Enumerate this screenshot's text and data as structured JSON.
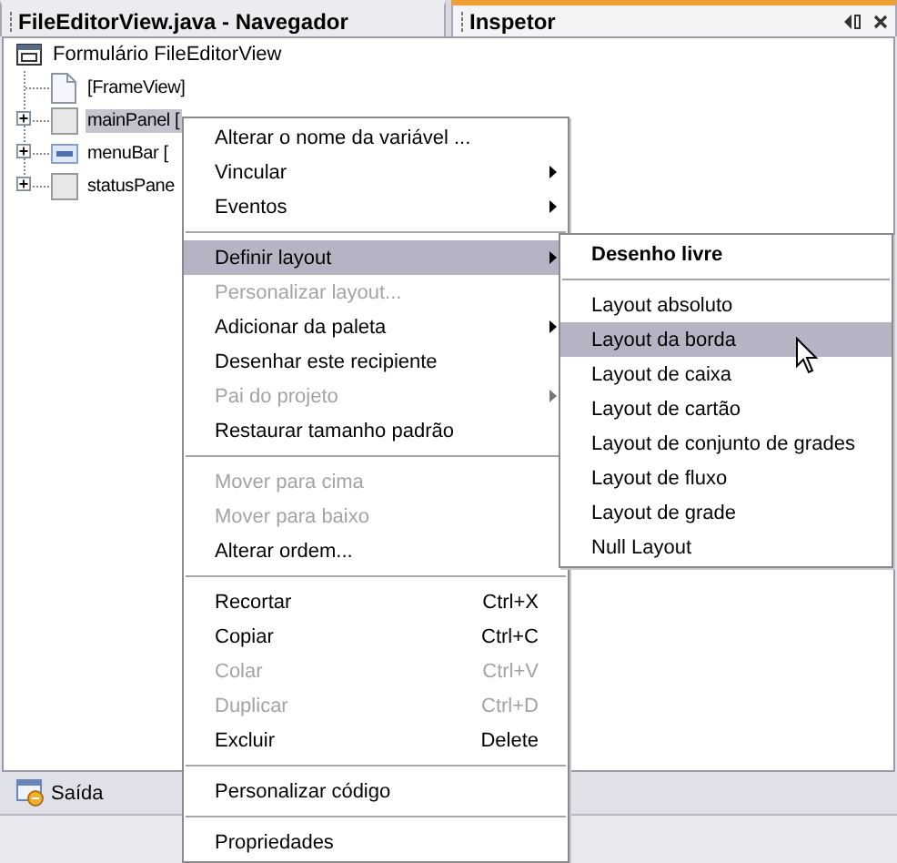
{
  "tabs": [
    {
      "label": "FileEditorView.java - Navegador",
      "selected": false
    },
    {
      "label": "Inspetor",
      "selected": true
    }
  ],
  "tree": {
    "label": "Formulário FileEditorView",
    "kind": "form",
    "children": [
      {
        "label": "[FrameView]",
        "kind": "frame",
        "expandable": false,
        "selected": false
      },
      {
        "label": "mainPanel [",
        "kind": "panel",
        "expandable": true,
        "selected": true
      },
      {
        "label": "menuBar [",
        "kind": "menubar",
        "expandable": true,
        "selected": false
      },
      {
        "label": "statusPane",
        "kind": "panel",
        "expandable": true,
        "selected": false
      }
    ]
  },
  "context_menu": {
    "items": [
      {
        "kind": "item",
        "label": "Alterar o nome da variável ...",
        "submenu": false,
        "disabled": false,
        "selected": false
      },
      {
        "kind": "item",
        "label": "Vincular",
        "submenu": true,
        "disabled": false,
        "selected": false
      },
      {
        "kind": "item",
        "label": "Eventos",
        "submenu": true,
        "disabled": false,
        "selected": false
      },
      {
        "kind": "separator"
      },
      {
        "kind": "item",
        "label": "Definir layout",
        "submenu": true,
        "disabled": false,
        "selected": true
      },
      {
        "kind": "item",
        "label": "Personalizar layout...",
        "submenu": false,
        "disabled": true,
        "selected": false
      },
      {
        "kind": "item",
        "label": "Adicionar da paleta",
        "submenu": true,
        "disabled": false,
        "selected": false
      },
      {
        "kind": "item",
        "label": "Desenhar este recipiente",
        "submenu": false,
        "disabled": false,
        "selected": false
      },
      {
        "kind": "item",
        "label": "Pai do projeto",
        "submenu": true,
        "disabled": true,
        "selected": false
      },
      {
        "kind": "item",
        "label": "Restaurar tamanho padrão",
        "submenu": false,
        "disabled": false,
        "selected": false
      },
      {
        "kind": "separator"
      },
      {
        "kind": "item",
        "label": "Mover para cima",
        "submenu": false,
        "disabled": true,
        "selected": false
      },
      {
        "kind": "item",
        "label": "Mover para baixo",
        "submenu": false,
        "disabled": true,
        "selected": false
      },
      {
        "kind": "item",
        "label": "Alterar ordem...",
        "submenu": false,
        "disabled": false,
        "selected": false
      },
      {
        "kind": "separator"
      },
      {
        "kind": "item",
        "label": "Recortar",
        "shortcut": "Ctrl+X",
        "submenu": false,
        "disabled": false,
        "selected": false
      },
      {
        "kind": "item",
        "label": "Copiar",
        "shortcut": "Ctrl+C",
        "submenu": false,
        "disabled": false,
        "selected": false
      },
      {
        "kind": "item",
        "label": "Colar",
        "shortcut": "Ctrl+V",
        "submenu": false,
        "disabled": true,
        "selected": false
      },
      {
        "kind": "item",
        "label": "Duplicar",
        "shortcut": "Ctrl+D",
        "submenu": false,
        "disabled": true,
        "selected": false
      },
      {
        "kind": "item",
        "label": "Excluir",
        "shortcut": "Delete",
        "submenu": false,
        "disabled": false,
        "selected": false
      },
      {
        "kind": "separator"
      },
      {
        "kind": "item",
        "label": "Personalizar código",
        "submenu": false,
        "disabled": false,
        "selected": false
      },
      {
        "kind": "separator"
      },
      {
        "kind": "item",
        "label": "Propriedades",
        "submenu": false,
        "disabled": false,
        "selected": false
      }
    ]
  },
  "layout_submenu": {
    "items": [
      {
        "kind": "default-item",
        "label": "Desenho livre",
        "submenu": false,
        "disabled": false,
        "selected": false
      },
      {
        "kind": "separator"
      },
      {
        "kind": "item",
        "label": "Layout absoluto",
        "submenu": false,
        "disabled": false,
        "selected": false
      },
      {
        "kind": "item",
        "label": "Layout da borda",
        "submenu": false,
        "disabled": false,
        "selected": true
      },
      {
        "kind": "item",
        "label": "Layout de caixa",
        "submenu": false,
        "disabled": false,
        "selected": false
      },
      {
        "kind": "item",
        "label": "Layout de cartão",
        "submenu": false,
        "disabled": false,
        "selected": false
      },
      {
        "kind": "item",
        "label": "Layout de conjunto de grades",
        "submenu": false,
        "disabled": false,
        "selected": false
      },
      {
        "kind": "item",
        "label": "Layout de fluxo",
        "submenu": false,
        "disabled": false,
        "selected": false
      },
      {
        "kind": "item",
        "label": "Layout de grade",
        "submenu": false,
        "disabled": false,
        "selected": false
      },
      {
        "kind": "item",
        "label": "Null Layout",
        "submenu": false,
        "disabled": false,
        "selected": false
      }
    ]
  },
  "output_button": {
    "label": "Saída"
  }
}
